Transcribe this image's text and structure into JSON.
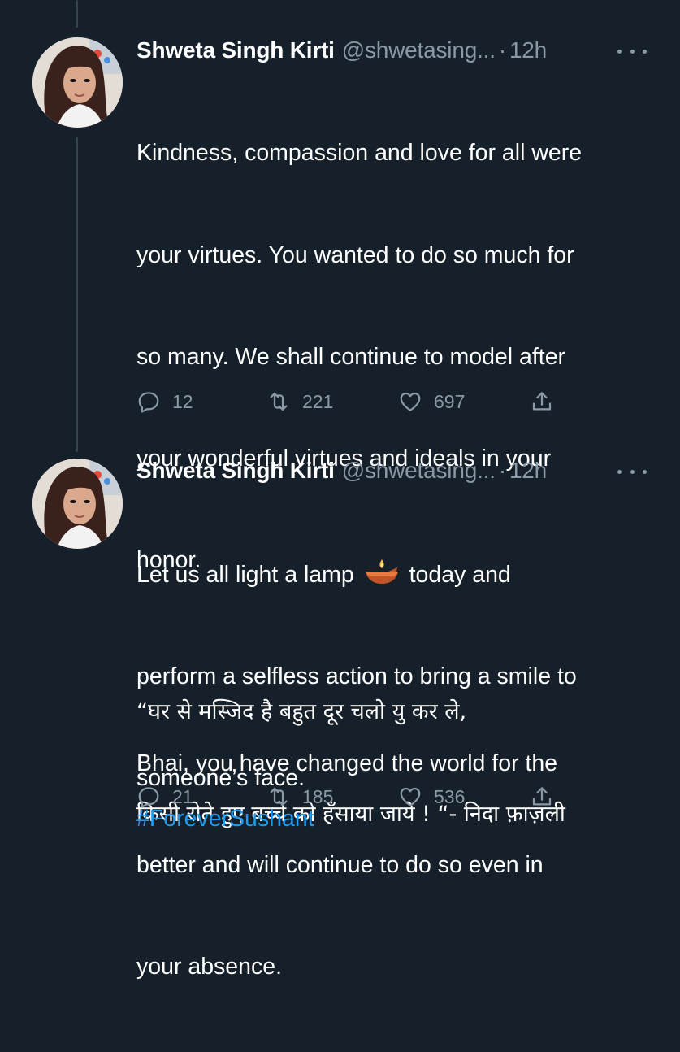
{
  "tweets": [
    {
      "author": "Shweta Singh Kirti",
      "handle": "@shwetasing...",
      "separator": "·",
      "time": "12h",
      "lines": [
        "Kindness, compassion and love for all were",
        "your virtues. You wanted to do so much for",
        "so many. We shall continue to model after",
        "your wonderful virtues and ideals in your",
        "honor.",
        "",
        "Bhai, you have changed the world for the",
        "better and will continue to do so even in",
        "your absence."
      ],
      "replies": "12",
      "retweets": "221",
      "likes": "697"
    },
    {
      "author": "Shweta Singh Kirti",
      "handle": "@shwetasing...",
      "separator": "·",
      "time": "12h",
      "line1_before": "Let us all light a lamp",
      "line1_after": "today and",
      "lines": [
        "perform a selfless action to bring a smile to",
        "someone’s face."
      ],
      "hindi_lines": [
        "“घर से मस्जिद है बहुत दूर चलो यु कर ले,",
        "किसी रोते हुए बच्चे को हँसाया जाये ! “- निदा  फ़ाज़ली"
      ],
      "hashtag": "#ForeverSushant",
      "replies": "21",
      "retweets": "185",
      "likes": "536"
    }
  ],
  "icons": {
    "reply": "reply-icon",
    "retweet": "retweet-icon",
    "like": "heart-icon",
    "share": "share-icon",
    "more": "more-icon",
    "lamp": "diya-lamp-emoji"
  },
  "colors": {
    "background": "#15202b",
    "text": "#ffffff",
    "secondary": "#8b98a5",
    "link": "#1d9bf0",
    "thread_line": "#38444d"
  }
}
